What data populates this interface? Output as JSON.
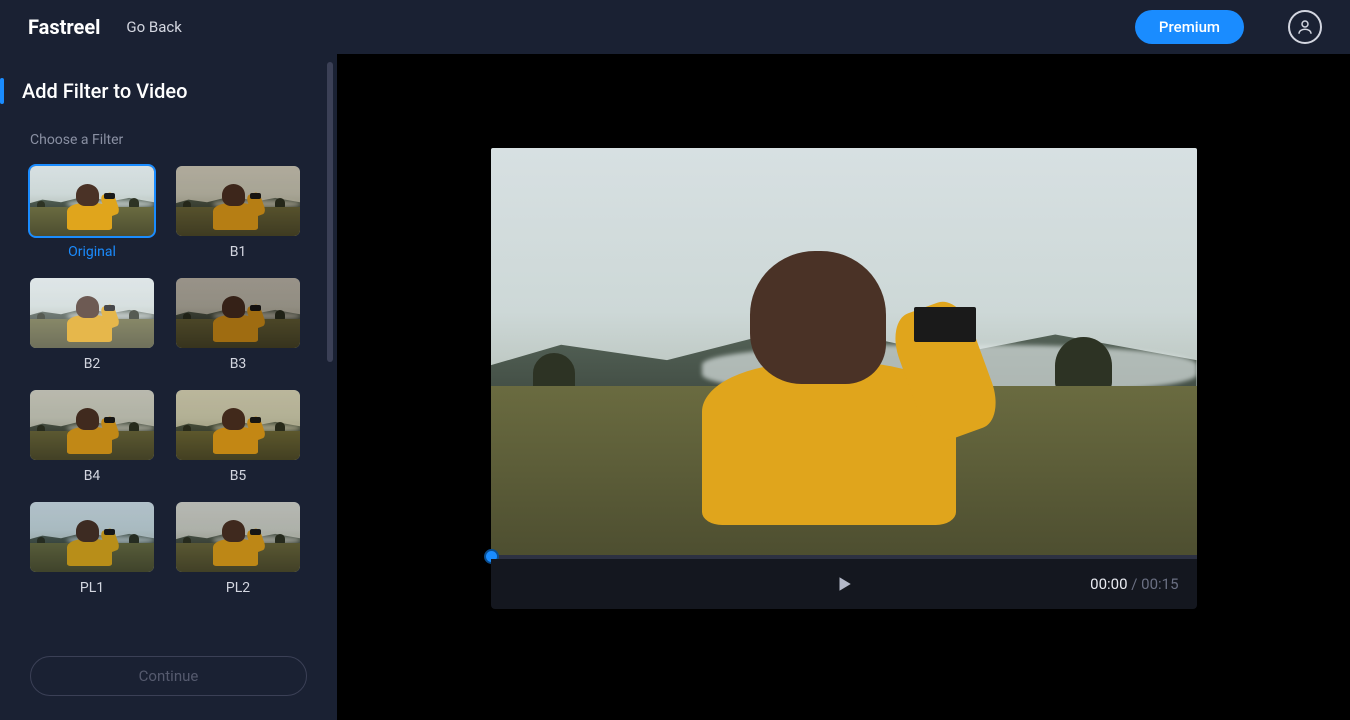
{
  "header": {
    "logo": "Fastreel",
    "go_back": "Go Back",
    "premium": "Premium"
  },
  "sidebar": {
    "title": "Add Filter to Video",
    "subtitle": "Choose a Filter",
    "continue": "Continue",
    "filters": [
      {
        "label": "Original",
        "class": "f-orig",
        "selected": true
      },
      {
        "label": "B1",
        "class": "f-b1",
        "selected": false
      },
      {
        "label": "B2",
        "class": "f-b2",
        "selected": false
      },
      {
        "label": "B3",
        "class": "f-b3",
        "selected": false
      },
      {
        "label": "B4",
        "class": "f-b4",
        "selected": false
      },
      {
        "label": "B5",
        "class": "f-b5",
        "selected": false
      },
      {
        "label": "PL1",
        "class": "f-pl1",
        "selected": false
      },
      {
        "label": "PL2",
        "class": "f-pl2",
        "selected": false
      }
    ]
  },
  "player": {
    "current_time": "00:00",
    "separator": " / ",
    "duration": "00:15"
  }
}
